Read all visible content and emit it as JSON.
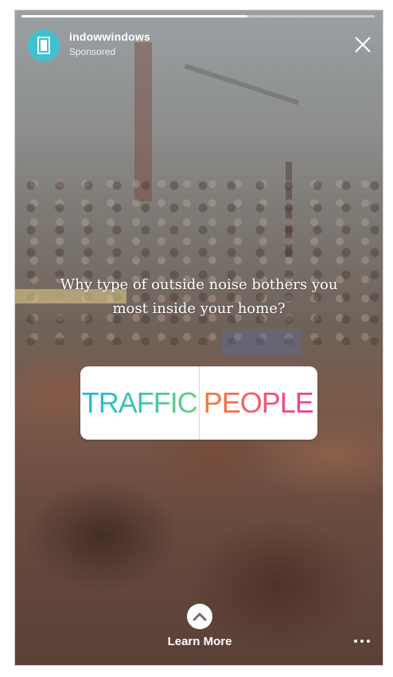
{
  "story": {
    "progress": 0.64,
    "account": {
      "name": "indowwindows",
      "label": "Sponsored",
      "avatar_color": "#3fc1cf",
      "avatar_icon": "window-icon"
    },
    "close_icon": "close-icon"
  },
  "poll": {
    "question": "Why type of outside noise bothers you most inside your home?",
    "options": [
      {
        "label": "TRAFFIC",
        "gradient": [
          "#22b7e0",
          "#5fd37a"
        ]
      },
      {
        "label": "PEOPLE",
        "gradient": [
          "#f47c3c",
          "#e83e9a"
        ]
      }
    ]
  },
  "cta": {
    "icon": "chevron-up-icon",
    "label": "Learn More",
    "more_icon": "more-options-icon"
  }
}
